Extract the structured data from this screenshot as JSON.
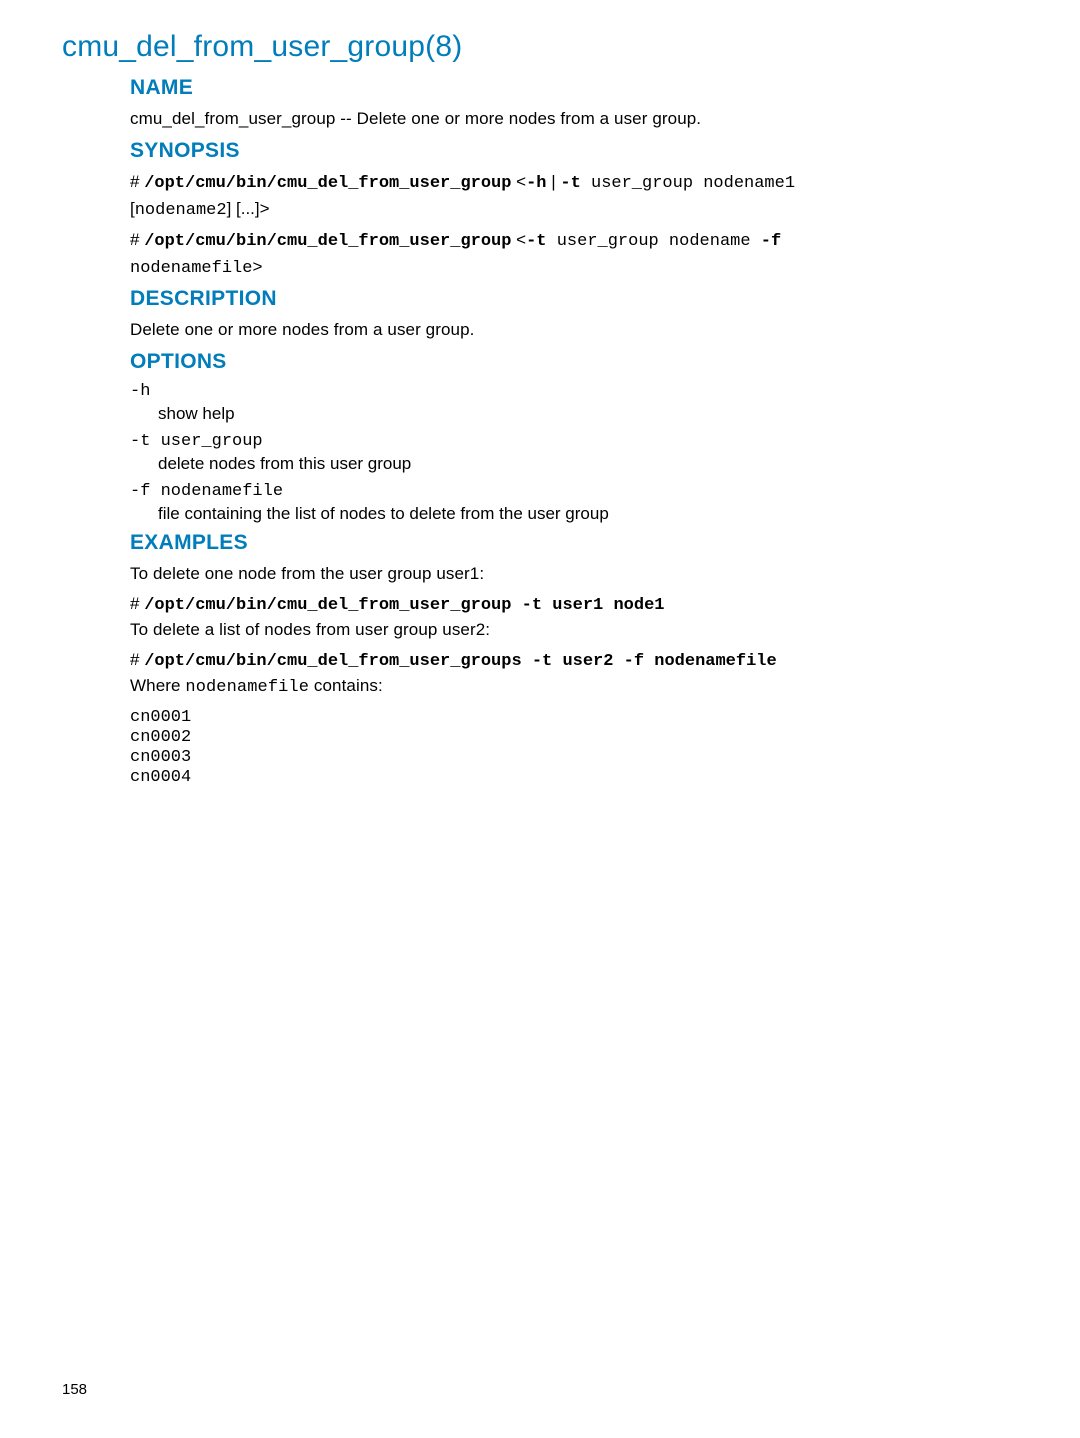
{
  "title": "cmu_del_from_user_group(8)",
  "sections": {
    "name": {
      "heading": "NAME",
      "text": "cmu_del_from_user_group -- Delete one or more nodes from a user group."
    },
    "synopsis": {
      "heading": "SYNOPSIS",
      "line1_prefix": "# ",
      "line1_cmd": "/opt/cmu/bin/cmu_del_from_user_group",
      "line1_mid": " <",
      "line1_opt1": "-h",
      "line1_pipe": " | ",
      "line1_opt2": "-t",
      "line1_tail": " user_group nodename1",
      "line1b_open": "[",
      "line1b_node": "nodename2",
      "line1b_close": "] [...]>",
      "line2_prefix": "# ",
      "line2_cmd": "/opt/cmu/bin/cmu_del_from_user_group",
      "line2_mid": " <",
      "line2_opt": "-t",
      "line2_tail1": " user_group nodename ",
      "line2_f": "-f",
      "line2_tail2": "nodenamefile>"
    },
    "description": {
      "heading": "DESCRIPTION",
      "text": "Delete one or more nodes from a user group."
    },
    "options": {
      "heading": "OPTIONS",
      "items": [
        {
          "term": "-h",
          "desc": "show help"
        },
        {
          "term": "-t user_group",
          "desc": "delete nodes from this user group"
        },
        {
          "term": "-f nodenamefile",
          "desc": "file containing the list of nodes to delete from the user group"
        }
      ]
    },
    "examples": {
      "heading": "EXAMPLES",
      "intro1": "To delete one node from the user group user1:",
      "cmd1_prefix": "# ",
      "cmd1": "/opt/cmu/bin/cmu_del_from_user_group -t user1 node1",
      "intro2": "To delete a list of nodes from user group user2:",
      "cmd2_prefix": "# ",
      "cmd2": "/opt/cmu/bin/cmu_del_from_user_groups -t user2 -f nodenamefile",
      "where_prefix": "Where ",
      "where_file": "nodenamefile",
      "where_suffix": " contains:",
      "nodes": "cn0001\ncn0002\ncn0003\ncn0004"
    }
  },
  "page_number": "158"
}
